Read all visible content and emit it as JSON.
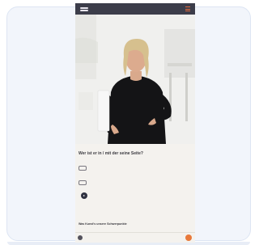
{
  "hero": {
    "image_alt": ""
  },
  "article": {
    "kicker": "",
    "heading": "Wer ist er in / mit der seine Seite?",
    "para1_lead": "",
    "para1_rest": "",
    "para2": "",
    "button1": "",
    "button2": "",
    "play_label": ""
  },
  "section2": {
    "kicker": "",
    "heading": "Was Kunst's unsere Schwerpunkte"
  },
  "bottom_nav": {
    "links": [
      "",
      "",
      "",
      ""
    ]
  },
  "colors": {
    "accent": "#e8793a",
    "nav_bg": "#3c3d4a",
    "page_bg": "#f4f2ee",
    "card_bg": "#f2f5fb"
  },
  "icons": {
    "logo": "brand-logo-icon",
    "menu": "hamburger-menu-icon",
    "play": "play-icon",
    "cookie": "cookie-settings-icon",
    "chat": "chat-bubble-icon"
  }
}
